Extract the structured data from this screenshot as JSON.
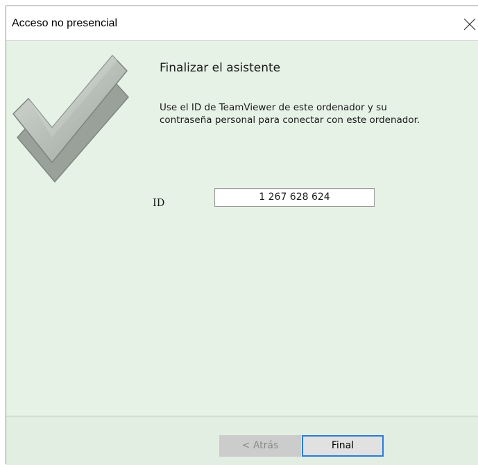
{
  "window": {
    "title": "Acceso no presencial",
    "close_icon": "close-icon"
  },
  "main": {
    "heading": "Finalizar el asistente",
    "description_line1": "Use el ID de TeamViewer de este ordenador y su",
    "description_line2": "contraseña personal para conectar con este ordenador.",
    "id_label": "ID",
    "id_value": "1 267 628 624",
    "graphic_icon": "checkmark-icon"
  },
  "footer": {
    "back_label": "< Atrás",
    "back_enabled": false,
    "final_label": "Final"
  },
  "colors": {
    "content_background": "#e6f2e6",
    "focus_border": "#2b7bd3",
    "disabled_button": "#cccccc"
  }
}
